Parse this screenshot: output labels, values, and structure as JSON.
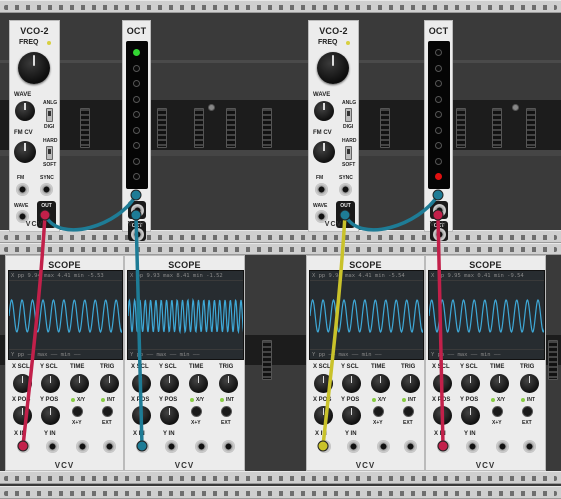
{
  "colors": {
    "cable_blue": "#1e7c96",
    "cable_red": "#c2204a",
    "cable_yellow": "#c9c22a",
    "trace": "#3ea9d8",
    "led_green": "#33d633",
    "led_red": "#e01010"
  },
  "vco": [
    {
      "title": "VCO-2",
      "freq_label": "FREQ",
      "wave_label": "WAVE",
      "anlg": "ANLG",
      "digi": "DIGI",
      "fmcv_label": "FM CV",
      "hard": "HARD",
      "soft": "SOFT",
      "fm": "FM",
      "sync": "SYNC",
      "wave_jack": "WAVE",
      "out": "OUT",
      "logo": "VCV"
    },
    {
      "title": "VCO-2",
      "freq_label": "FREQ",
      "wave_label": "WAVE",
      "anlg": "ANLG",
      "digi": "DIGI",
      "fmcv_label": "FM CV",
      "hard": "HARD",
      "soft": "SOFT",
      "fm": "FM",
      "sync": "SYNC",
      "wave_jack": "WAVE",
      "out": "OUT",
      "logo": "VCV"
    }
  ],
  "oct": [
    {
      "title": "OCT",
      "in": "IN",
      "out": "OCT",
      "logo": "VCV",
      "active_led_index": 0,
      "active_led_color": "green"
    },
    {
      "title": "OCT",
      "in": "IN",
      "out": "OCT",
      "logo": "VCV",
      "active_led_index": 8,
      "active_led_color": "red"
    }
  ],
  "scopes": [
    {
      "title": "SCOPE",
      "top": "X  pp  9.94  max  4.41  min  -5.53",
      "bot": "Y  pp  ——  max  ——  min  ——",
      "cycles": 11,
      "xscl": "X SCL",
      "yscl": "Y SCL",
      "time": "TIME",
      "trig": "TRIG",
      "xpos": "X POS",
      "ypos": "Y POS",
      "xy": "X/Y",
      "int": "INT",
      "xpy": "X+Y",
      "ext": "EXT",
      "xin": "X IN",
      "yin": "Y IN",
      "logo": "VCV"
    },
    {
      "title": "SCOPE",
      "top": "X  pp  9.93  max  8.41  min  -1.52",
      "bot": "Y  pp  ——  max  ——  min  ——",
      "cycles": 22,
      "xscl": "X SCL",
      "yscl": "Y SCL",
      "time": "TIME",
      "trig": "TRIG",
      "xpos": "X POS",
      "ypos": "Y POS",
      "xy": "X/Y",
      "int": "INT",
      "xpy": "X+Y",
      "ext": "EXT",
      "xin": "X IN",
      "yin": "Y IN",
      "logo": "VCV"
    },
    {
      "title": "SCOPE",
      "top": "X  pp  9.94  max  4.41  min  -5.54",
      "bot": "Y  pp  ——  max  ——  min  ——",
      "cycles": 11,
      "xscl": "X SCL",
      "yscl": "Y SCL",
      "time": "TIME",
      "trig": "TRIG",
      "xpos": "X POS",
      "ypos": "Y POS",
      "xy": "X/Y",
      "int": "INT",
      "xpy": "X+Y",
      "ext": "EXT",
      "xin": "X IN",
      "yin": "Y IN",
      "logo": "VCV"
    },
    {
      "title": "SCOPE",
      "top": "X  pp  9.95  max  0.41  min  -9.54",
      "bot": "Y  pp  ——  max  ——  min  ——",
      "cycles": 11,
      "xscl": "X SCL",
      "yscl": "Y SCL",
      "time": "TIME",
      "trig": "TRIG",
      "xpos": "X POS",
      "ypos": "Y POS",
      "xy": "X/Y",
      "int": "INT",
      "xpy": "X+Y",
      "ext": "EXT",
      "xin": "X IN",
      "yin": "Y IN",
      "logo": "VCV"
    }
  ]
}
